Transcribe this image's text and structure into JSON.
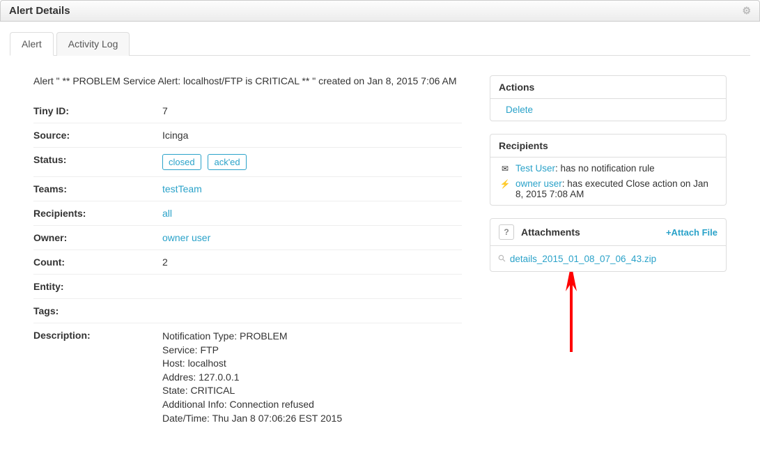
{
  "header": {
    "title": "Alert Details"
  },
  "tabs": [
    {
      "label": "Alert",
      "active": true
    },
    {
      "label": "Activity Log",
      "active": false
    }
  ],
  "summary": "Alert \" ** PROBLEM Service Alert: localhost/FTP is CRITICAL ** \" created on Jan 8, 2015 7:06 AM",
  "details": {
    "tiny_id_label": "Tiny ID:",
    "tiny_id_value": "7",
    "source_label": "Source:",
    "source_value": "Icinga",
    "status_label": "Status:",
    "status_badges": [
      "closed",
      "ack'ed"
    ],
    "teams_label": "Teams:",
    "teams_value": "testTeam",
    "recipients_label": "Recipients:",
    "recipients_value": "all",
    "owner_label": "Owner:",
    "owner_value": "owner user",
    "count_label": "Count:",
    "count_value": "2",
    "entity_label": "Entity:",
    "entity_value": "",
    "tags_label": "Tags:",
    "tags_value": "",
    "description_label": "Description:",
    "description_lines": [
      "Notification Type: PROBLEM",
      "Service: FTP",
      "Host: localhost",
      "Addres: 127.0.0.1",
      "State: CRITICAL",
      "Additional Info: Connection refused",
      "Date/Time: Thu Jan 8 07:06:26 EST 2015"
    ]
  },
  "actions": {
    "header": "Actions",
    "delete": "Delete"
  },
  "recipients_panel": {
    "header": "Recipients",
    "items": [
      {
        "icon": "mail-icon",
        "glyph": "✉",
        "name": "Test User",
        "text": ": has no notification rule"
      },
      {
        "icon": "bolt-icon",
        "glyph": "⚡",
        "name": "owner user",
        "text": ": has executed Close action on Jan 8, 2015 7:08 AM"
      }
    ]
  },
  "attachments": {
    "help": "?",
    "header": "Attachments",
    "add_label": "+Attach File",
    "files": [
      {
        "name": "details_2015_01_08_07_06_43.zip"
      }
    ]
  }
}
